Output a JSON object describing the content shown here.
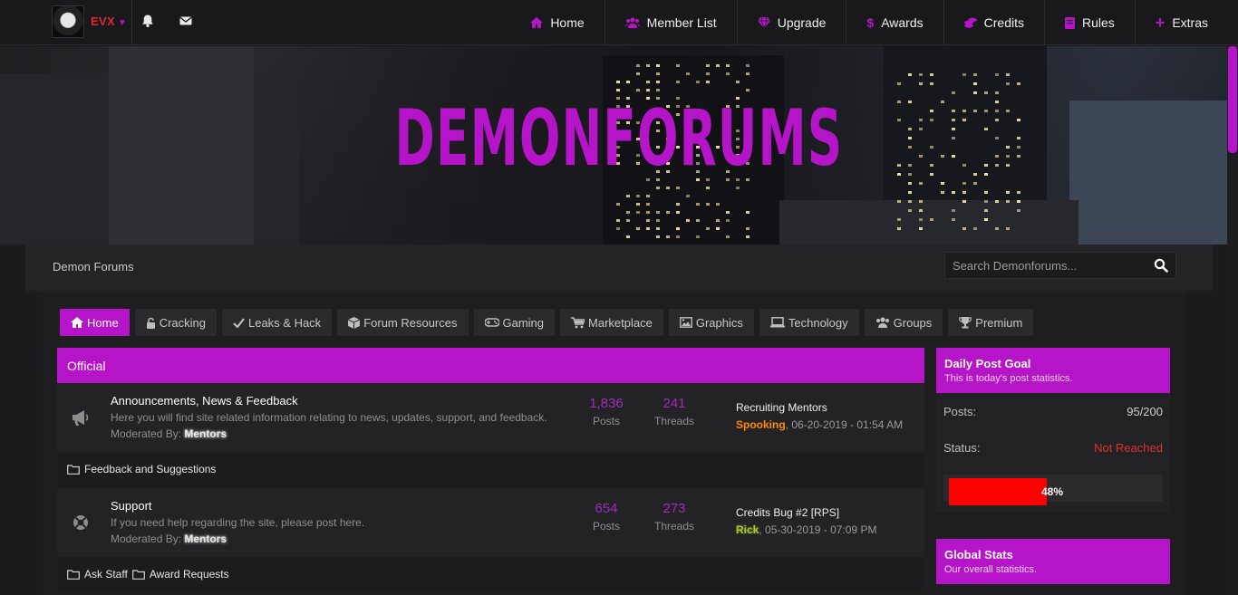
{
  "user": {
    "name": "EVX"
  },
  "nav": {
    "items": [
      {
        "label": "Home",
        "icon": "home-icon"
      },
      {
        "label": "Member List",
        "icon": "users-icon"
      },
      {
        "label": "Upgrade",
        "icon": "diamond-icon"
      },
      {
        "label": "Awards",
        "icon": "dollar-icon"
      },
      {
        "label": "Credits",
        "icon": "coins-icon"
      },
      {
        "label": "Rules",
        "icon": "book-icon"
      },
      {
        "label": "Extras",
        "icon": "plus-icon"
      }
    ]
  },
  "banner": {
    "title": "DEMONFORUMS"
  },
  "breadcrumb": {
    "label": "Demon Forums"
  },
  "search": {
    "placeholder": "Search Demonforums..."
  },
  "tabs": [
    {
      "label": "Home",
      "icon": "home-icon",
      "active": true
    },
    {
      "label": "Cracking",
      "icon": "lock-icon"
    },
    {
      "label": "Leaks & Hack",
      "icon": "check-icon"
    },
    {
      "label": "Forum Resources",
      "icon": "cube-icon"
    },
    {
      "label": "Gaming",
      "icon": "gamepad-icon"
    },
    {
      "label": "Marketplace",
      "icon": "cart-icon"
    },
    {
      "label": "Graphics",
      "icon": "image-icon"
    },
    {
      "label": "Technology",
      "icon": "laptop-icon"
    },
    {
      "label": "Groups",
      "icon": "users-icon"
    },
    {
      "label": "Premium",
      "icon": "trophy-icon"
    }
  ],
  "section": {
    "title": "Official",
    "forums": [
      {
        "name": "Announcements, News & Feedback",
        "description": "Here you will find site related information relating to news, updates, support, and feedback.",
        "moderated_label": "Moderated By:",
        "moderator": "Mentors",
        "posts": "1,836",
        "posts_label": "Posts",
        "threads": "241",
        "threads_label": "Threads",
        "last_title": "Recruiting Mentors",
        "last_user": "Spooking",
        "last_time": ", 06-20-2019 - 01:54 AM",
        "icon": "megaphone-icon",
        "subforums": [
          "Feedback and Suggestions"
        ]
      },
      {
        "name": "Support",
        "description": "If you need help regarding the site, please post here.",
        "moderated_label": "Moderated By:",
        "moderator": "Mentors",
        "posts": "654",
        "posts_label": "Posts",
        "threads": "273",
        "threads_label": "Threads",
        "last_title": "Credits Bug #2 [RPS]",
        "last_user": "Rick",
        "last_time": ", 05-30-2019 - 07:09 PM",
        "icon": "lifebuoy-icon",
        "subforums": [
          "Ask Staff",
          "Award Requests"
        ]
      }
    ]
  },
  "sidebar": {
    "daily": {
      "title": "Daily Post Goal",
      "subtitle": "This is today's post statistics.",
      "posts_label": "Posts:",
      "posts_value": "95/200",
      "status_label": "Status:",
      "status_value": "Not Reached",
      "progress_label": "48%",
      "progress": 0.48
    },
    "global": {
      "title": "Global Stats",
      "subtitle": "Our overall statistics."
    }
  },
  "colors": {
    "accent": "#b514c9",
    "bg": "#1b1b1e",
    "progress": "#ff0000",
    "status_bad": "#e03030"
  }
}
